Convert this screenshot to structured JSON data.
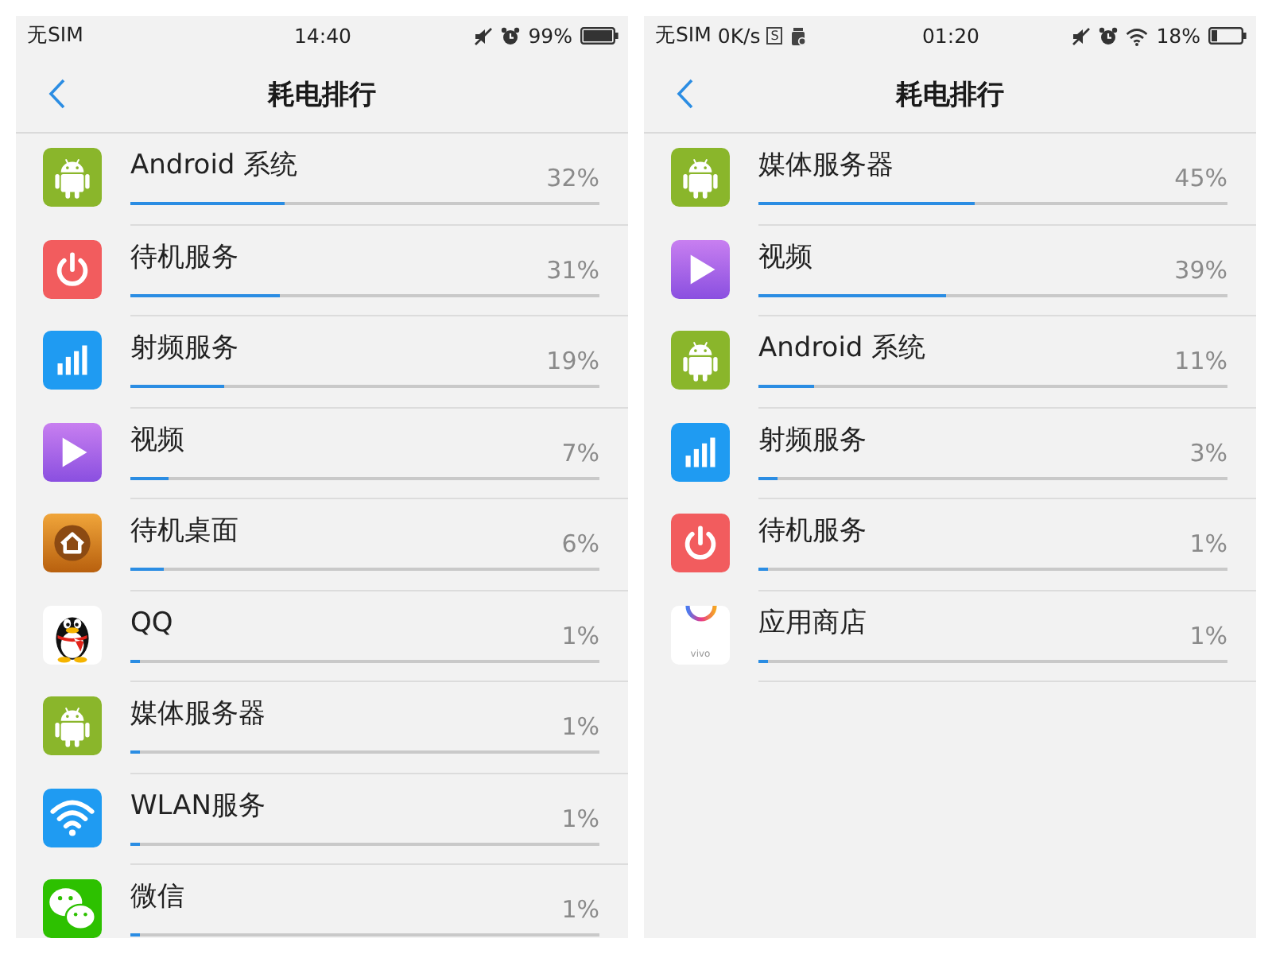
{
  "panels": [
    {
      "status_bar": {
        "left_items": [
          {
            "kind": "text",
            "text": "无SIM"
          }
        ],
        "time": "14:40",
        "right_icons": [
          {
            "kind": "mute"
          },
          {
            "kind": "alarm"
          }
        ],
        "battery_text": "99%",
        "battery_low": false
      },
      "header": {
        "title": "耗电排行"
      },
      "apps": [
        {
          "kind": "android",
          "name": "Android 系统",
          "percent": "32%",
          "level": 0.33
        },
        {
          "kind": "power",
          "name": "待机服务",
          "percent": "31%",
          "level": 0.32
        },
        {
          "kind": "signal",
          "name": "射频服务",
          "percent": "19%",
          "level": 0.2
        },
        {
          "kind": "video",
          "name": "视频",
          "percent": "7%",
          "level": 0.08
        },
        {
          "kind": "home",
          "name": "待机桌面",
          "percent": "6%",
          "level": 0.07
        },
        {
          "kind": "qq",
          "name": "QQ",
          "percent": "1%",
          "level": 0.02
        },
        {
          "kind": "android",
          "name": "媒体服务器",
          "percent": "1%",
          "level": 0.02
        },
        {
          "kind": "wifi",
          "name": "WLAN服务",
          "percent": "1%",
          "level": 0.02
        },
        {
          "kind": "wechat",
          "name": "微信",
          "percent": "1%",
          "level": 0.02
        }
      ]
    },
    {
      "status_bar": {
        "left_items": [
          {
            "kind": "text",
            "text": "无SIM"
          },
          {
            "kind": "text",
            "text": "0K/s"
          },
          {
            "kind": "badge",
            "text": "S"
          },
          {
            "kind": "jar"
          }
        ],
        "time": "01:20",
        "right_icons": [
          {
            "kind": "mute"
          },
          {
            "kind": "alarm"
          },
          {
            "kind": "wifi"
          }
        ],
        "battery_text": "18%",
        "battery_low": true
      },
      "header": {
        "title": "耗电排行"
      },
      "apps": [
        {
          "kind": "android",
          "name": "媒体服务器",
          "percent": "45%",
          "level": 0.46
        },
        {
          "kind": "video",
          "name": "视频",
          "percent": "39%",
          "level": 0.4
        },
        {
          "kind": "android",
          "name": "Android 系统",
          "percent": "11%",
          "level": 0.12
        },
        {
          "kind": "signal",
          "name": "射频服务",
          "percent": "3%",
          "level": 0.04
        },
        {
          "kind": "power",
          "name": "待机服务",
          "percent": "1%",
          "level": 0.02
        },
        {
          "kind": "store",
          "name": "应用商店",
          "percent": "1%",
          "level": 0.02,
          "icon_text": "vivo"
        }
      ]
    }
  ]
}
